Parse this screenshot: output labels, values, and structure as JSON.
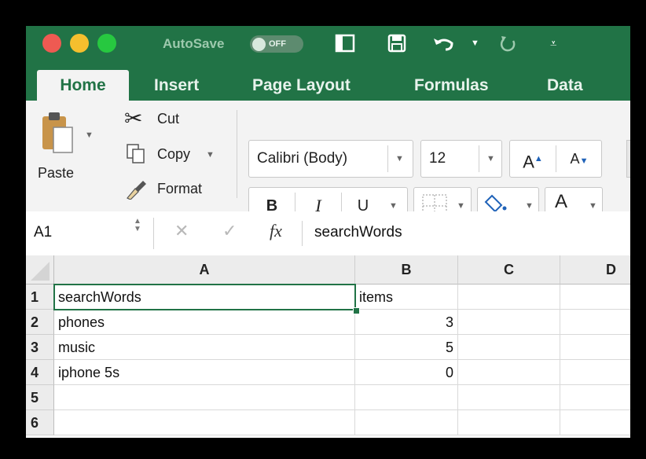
{
  "titlebar": {
    "autosave_label": "AutoSave",
    "autosave_state": "OFF",
    "colors": {
      "close": "#ee5a52",
      "minimize": "#f5bf2e",
      "zoom": "#27c840",
      "accent": "#217346"
    }
  },
  "tabs": [
    {
      "label": "Home"
    },
    {
      "label": "Insert"
    },
    {
      "label": "Page Layout"
    },
    {
      "label": "Formulas"
    },
    {
      "label": "Data"
    }
  ],
  "clipboard": {
    "paste_label": "Paste",
    "cut_label": "Cut",
    "copy_label": "Copy",
    "format_label": "Format"
  },
  "font": {
    "name": "Calibri (Body)",
    "size": "12",
    "bold": "B",
    "italic": "I",
    "underline": "U",
    "grow": "A",
    "shrink": "A",
    "font_color": "A",
    "highlight_color": "#ffef00",
    "text_color": "#e31c1c"
  },
  "formula_bar": {
    "name_box": "A1",
    "fx": "fx",
    "content": "searchWords"
  },
  "sheet": {
    "columns": [
      "A",
      "B",
      "C",
      "D"
    ],
    "rows": [
      "1",
      "2",
      "3",
      "4",
      "5",
      "6"
    ],
    "cells": [
      [
        "searchWords",
        "items",
        "",
        ""
      ],
      [
        "phones",
        "3",
        "",
        ""
      ],
      [
        "music",
        "5",
        "",
        ""
      ],
      [
        "iphone 5s",
        "0",
        "",
        ""
      ],
      [
        "",
        "",
        "",
        ""
      ],
      [
        "",
        "",
        "",
        ""
      ]
    ],
    "selected_cell": "A1"
  }
}
